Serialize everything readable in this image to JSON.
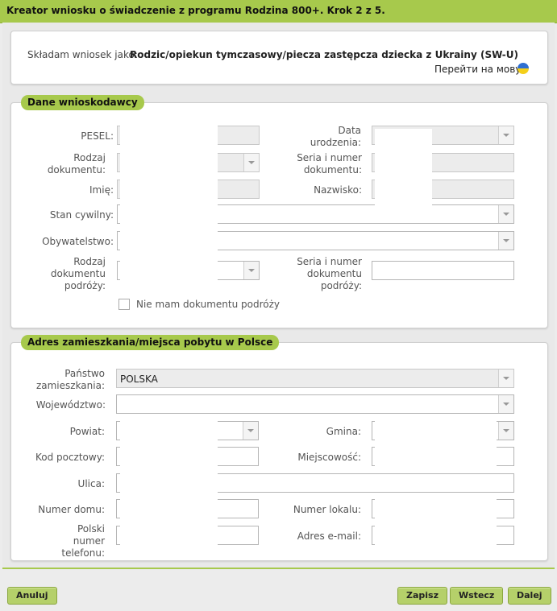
{
  "window": {
    "title": "Kreator wniosku o świadczenie z programu Rodzina 800+. Krok 2 z 5."
  },
  "applicant_type": {
    "label": "Składam wniosek jako:",
    "value": "Rodzic/opiekun tymczasowy/piecza zastępcza dziecka z Ukrainy (SW-U)",
    "language_link": "Перейти на мову:",
    "language_flag": "ukraine-flag-icon"
  },
  "applicant": {
    "legend": "Dane wnioskodawcy",
    "pesel_label": "PESEL:",
    "birth_date_label": "Data urodzenia:",
    "doc_type_label": "Rodzaj dokumentu:",
    "doc_number_label": "Seria i numer dokumentu:",
    "first_name_label": "Imię:",
    "last_name_label": "Nazwisko:",
    "marital_label": "Stan cywilny:",
    "citizenship_label": "Obywatelstwo:",
    "travel_doc_type_label": "Rodzaj dokumentu podróży:",
    "travel_doc_number_label": "Seria i numer dokumentu podróży:",
    "no_travel_doc_label": "Nie mam dokumentu podróży",
    "no_travel_doc_checked": false
  },
  "address": {
    "legend": "Adres zamieszkania/miejsca pobytu w Polsce",
    "country_label": "Państwo zamieszkania:",
    "country_value": "POLSKA",
    "voivodeship_label": "Województwo:",
    "county_label": "Powiat:",
    "commune_label": "Gmina:",
    "postal_label": "Kod pocztowy:",
    "city_label": "Miejscowość:",
    "street_label": "Ulica:",
    "house_label": "Numer domu:",
    "flat_label": "Numer lokalu:",
    "phone_label": "Polski numer telefonu:",
    "email_label": "Adres e-mail:"
  },
  "buttons": {
    "cancel": "Anuluj",
    "save": "Zapisz",
    "back": "Wstecz",
    "next": "Dalej"
  }
}
